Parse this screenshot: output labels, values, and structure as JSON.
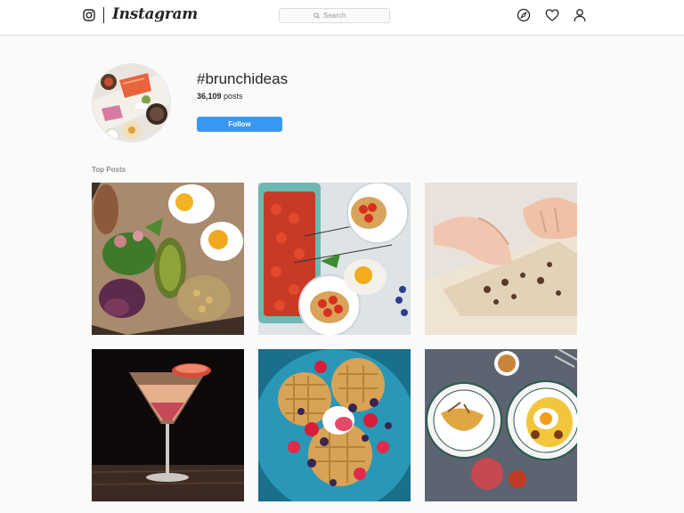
{
  "header": {
    "logo_text": "Instagram",
    "search": {
      "placeholder": "Search"
    },
    "nav_icons": [
      "explore-icon",
      "heart-icon",
      "profile-icon"
    ]
  },
  "profile": {
    "hashtag": "#brunchideas",
    "post_count": "36,109",
    "post_suffix": " posts",
    "follow_label": "Follow"
  },
  "section": {
    "label": "Top Posts"
  },
  "colors": {
    "accent": "#3897f0",
    "border": "#dbdbdb",
    "muted": "#8e8e8e",
    "background": "#fafafa"
  },
  "posts": [
    {
      "name": "post-eggs-avocado",
      "subject": "eggs-avocado-board"
    },
    {
      "name": "post-tomato-toast",
      "subject": "tomato-toast-eggs"
    },
    {
      "name": "post-dough-rolling",
      "subject": "rolling-dough"
    },
    {
      "name": "post-cocktail",
      "subject": "martini-cocktail"
    },
    {
      "name": "post-waffle-berries",
      "subject": "waffles-berries"
    },
    {
      "name": "post-plates-table",
      "subject": "brunch-plates"
    }
  ]
}
